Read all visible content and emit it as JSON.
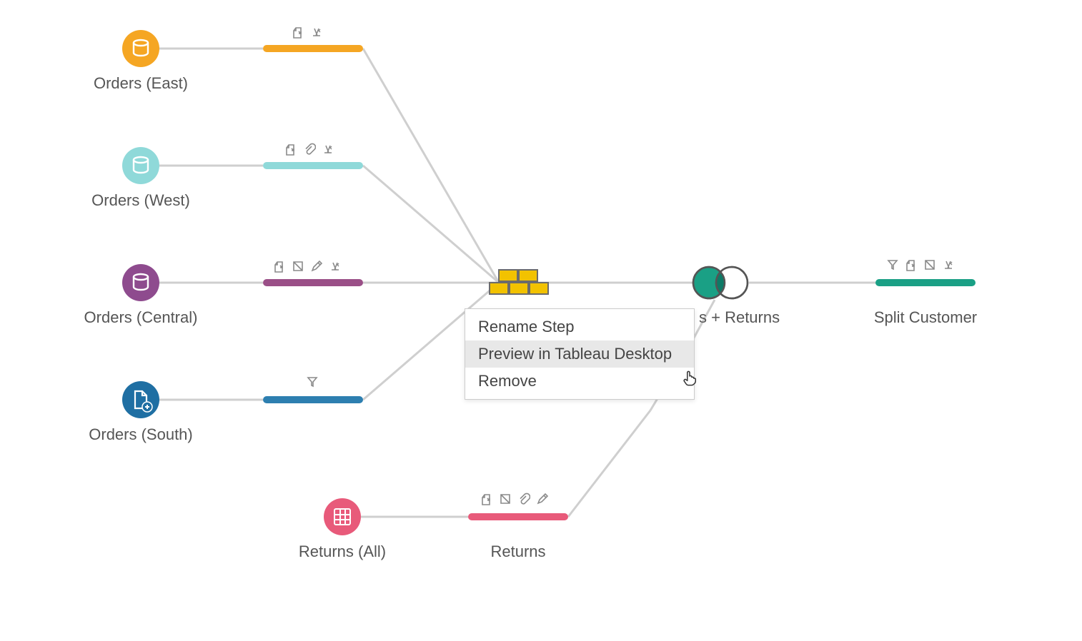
{
  "nodes": {
    "orders_east": {
      "label": "Orders (East)",
      "color": "#f5a623"
    },
    "orders_west": {
      "label": "Orders (West)",
      "color": "#7fd1d1"
    },
    "orders_central": {
      "label": "Orders (Central)",
      "color": "#8e4b8e"
    },
    "orders_south": {
      "label": "Orders (South)",
      "color": "#1f6fa3"
    },
    "returns_all": {
      "label": "Returns (All)",
      "color": "#e85a7a"
    },
    "returns_clean": {
      "label": "Returns",
      "color": "#e85a7a"
    },
    "union": {
      "label": "",
      "color": "#f2c200"
    },
    "join": {
      "label": "s + Returns",
      "color": "#1aa085"
    },
    "split_customer": {
      "label": "Split Customer",
      "color": "#1aa085"
    },
    "clean_east": {
      "color": "#f5a623"
    },
    "clean_west": {
      "color": "#7fd1d1"
    },
    "clean_central": {
      "color": "#8e4b8e"
    },
    "clean_south": {
      "color": "#1f6fa3"
    }
  },
  "context_menu": {
    "items": [
      {
        "key": "rename",
        "label": "Rename Step"
      },
      {
        "key": "preview",
        "label": "Preview in Tableau Desktop",
        "hover": true
      },
      {
        "key": "remove",
        "label": "Remove"
      }
    ]
  },
  "icon_strips": {
    "clean_east": [
      "export-icon",
      "retype-icon"
    ],
    "clean_west": [
      "export-icon",
      "attach-icon",
      "retype-icon"
    ],
    "clean_central": [
      "export-icon",
      "remove-col-icon",
      "edit-icon",
      "retype-icon"
    ],
    "clean_south": [
      "filter-icon"
    ],
    "returns_clean": [
      "export-icon",
      "remove-col-icon",
      "attach-icon",
      "edit-icon"
    ],
    "split_customer": [
      "filter-icon",
      "export-icon",
      "remove-col-icon",
      "retype-icon"
    ]
  }
}
